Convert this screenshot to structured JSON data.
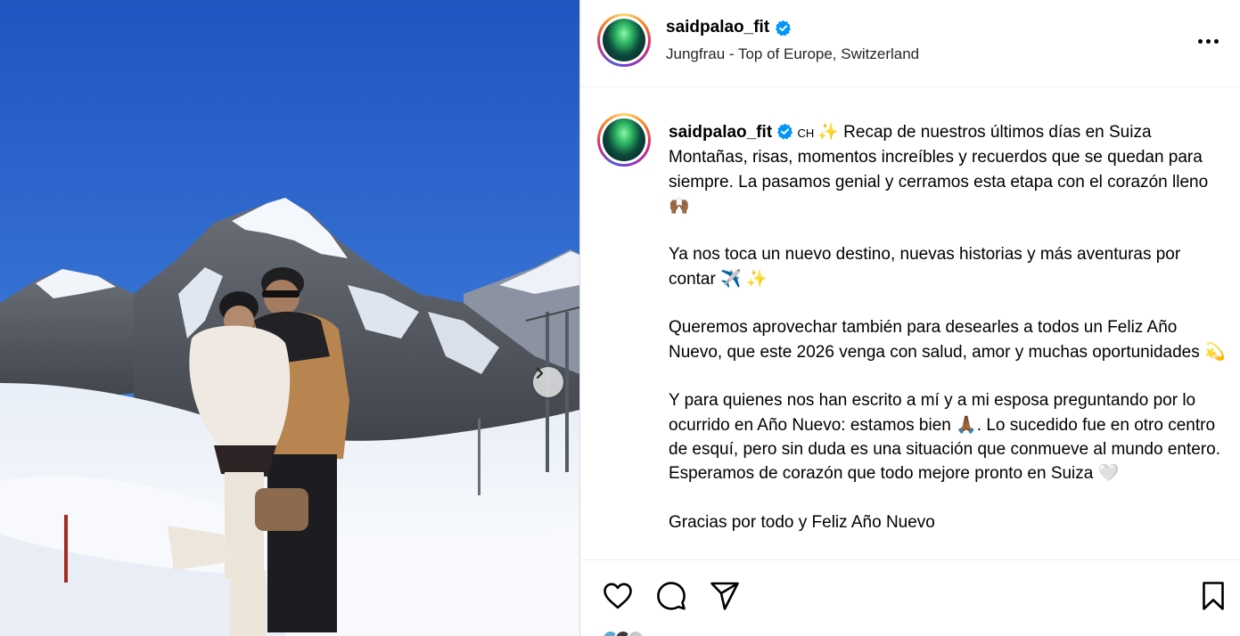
{
  "post": {
    "username": "saidpalao_fit",
    "location": "Jungfrau - Top of Europe, Switzerland"
  },
  "caption": {
    "username": "saidpalao_fit",
    "country_code": "CH",
    "paragraphs": [
      "✨ Recap de nuestros últimos días en Suiza\nMontañas, risas, momentos increíbles y recuerdos que se quedan para siempre. La pasamos genial y cerramos esta etapa con el corazón lleno 🙌🏾",
      "Ya nos toca un nuevo destino, nuevas historias y más aventuras por contar ✈️ ✨",
      "Queremos aprovechar también para desearles a todos un Feliz Año Nuevo, que este 2026 venga con salud, amor y muchas oportunidades 💫",
      "Y para quienes nos han escrito a mí y a mi esposa preguntando por lo ocurrido en Año Nuevo: estamos bien 🙏🏾. Lo sucedido fue en otro centro de esquí, pero sin duda es una situación que conmueve al mundo entero. Esperamos de corazón que todo mejore pronto en Suiza 🤍",
      "Gracias por todo y Feliz Año Nuevo"
    ]
  },
  "icons": {
    "verified": "verified-badge-icon",
    "more": "more-options-icon",
    "next": "chevron-right-icon",
    "like": "heart-icon",
    "comment": "comment-bubble-icon",
    "share": "paper-plane-icon",
    "save": "bookmark-icon"
  },
  "colors": {
    "verified": "#0095f6",
    "sky": "#2a62c9",
    "border": "#dbdbdb"
  }
}
